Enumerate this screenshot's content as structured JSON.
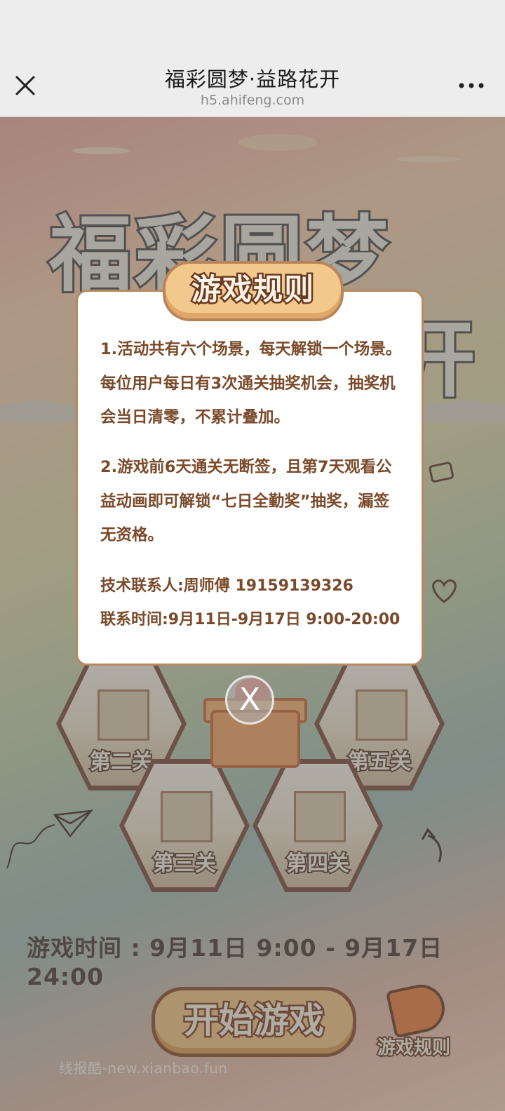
{
  "nav": {
    "title": "福彩圆梦·益路花开",
    "url": "h5.ahifeng.com"
  },
  "background": {
    "title_line1": "福彩圆梦",
    "title_line2_visible": "开",
    "levels": [
      {
        "label": "第二关"
      },
      {
        "label": "第五关"
      },
      {
        "label": "第三关"
      },
      {
        "label": "第四关"
      }
    ],
    "game_time": "游戏时间 : 9月11日 9:00 - 9月17日 24:00",
    "start_button": "开始游戏",
    "rules_button": "游戏规则",
    "watermark": "线报酷-new.xianbao.fun"
  },
  "modal": {
    "title": "游戏规则",
    "rule1": "1.活动共有六个场景，每天解锁一个场景。每位用户每日有3次通关抽奖机会，抽奖机会当日清零，不累计叠加。",
    "rule2": "2.游戏前6天通关无断签，且第7天观看公益动画即可解锁“七日全勤奖”抽奖，漏签无资格。",
    "contact": "技术联系人:周师傅 19159139326",
    "contact_time": "联系时间:9月11日-9月17日   9:00-20:00",
    "close_label": "X"
  },
  "colors": {
    "modal_text": "#7a4a2a",
    "pill": "#f2c88c",
    "overlay": "rgba(90,90,90,0.45)"
  }
}
